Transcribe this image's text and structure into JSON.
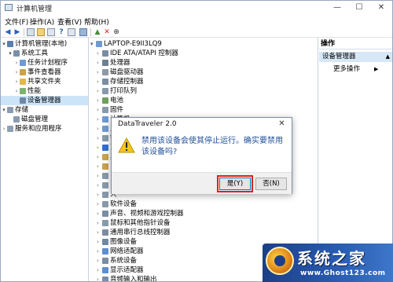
{
  "window": {
    "title": "计算机管理",
    "min": "—",
    "max": "☐",
    "close": "✕"
  },
  "menu": [
    "文件(F)",
    "操作(A)",
    "查看(V)",
    "帮助(H)"
  ],
  "tree": [
    {
      "label": "计算机管理(本地)",
      "arrow": "▾",
      "color": "#5b7fae"
    },
    {
      "label": "系统工具",
      "arrow": "▾",
      "color": "#7a8fa8"
    },
    {
      "label": "任务计划程序",
      "arrow": "›",
      "color": "#6e9ad1"
    },
    {
      "label": "事件查看器",
      "arrow": "›",
      "color": "#c9a24a"
    },
    {
      "label": "共享文件夹",
      "arrow": "›",
      "color": "#e3b84c"
    },
    {
      "label": "性能",
      "arrow": "›",
      "color": "#7fb26f"
    },
    {
      "label": "设备管理器",
      "arrow": "",
      "color": "#6f88a6",
      "selected": true
    },
    {
      "label": "存储",
      "arrow": "▾",
      "color": "#8b9bb0"
    },
    {
      "label": "磁盘管理",
      "arrow": "",
      "color": "#8b9bb0"
    },
    {
      "label": "服务和应用程序",
      "arrow": "›",
      "color": "#8fa0b4"
    }
  ],
  "devices": {
    "root": "LAPTOP-E9II3LQ9",
    "items": [
      {
        "label": "IDE ATA/ATAPI 控制器",
        "color": "#7b8da3"
      },
      {
        "label": "处理器",
        "color": "#6f7f92"
      },
      {
        "label": "磁盘驱动器",
        "color": "#8d99a6"
      },
      {
        "label": "存储控制器",
        "color": "#7b8da3"
      },
      {
        "label": "打印队列",
        "color": "#8899aa"
      },
      {
        "label": "电池",
        "color": "#6ea05a"
      },
      {
        "label": "固件",
        "color": "#8899aa"
      },
      {
        "label": "计算机",
        "color": "#6f9ad1"
      },
      {
        "label": "监",
        "color": "#6f9ad1"
      },
      {
        "label": "键",
        "color": "#8899aa"
      },
      {
        "label": "蓝",
        "color": "#2f6fd1"
      },
      {
        "label": "其",
        "color": "#c9a24a"
      },
      {
        "label": "",
        "color": "#c9a24a"
      },
      {
        "label": "",
        "color": "#8899aa"
      },
      {
        "label": "",
        "color": "#8899aa"
      },
      {
        "label": "人",
        "color": "#8899aa"
      },
      {
        "label": "软件设备",
        "color": "#8899aa"
      },
      {
        "label": "声音、视频和游戏控制器",
        "color": "#7b8da3"
      },
      {
        "label": "鼠标和其他指针设备",
        "color": "#8899aa"
      },
      {
        "label": "通用串行总线控制器",
        "color": "#7b8da3"
      },
      {
        "label": "图像设备",
        "color": "#6f88a6"
      },
      {
        "label": "网络适配器",
        "color": "#5b8fd1"
      },
      {
        "label": "系统设备",
        "color": "#7b8da3"
      },
      {
        "label": "显示适配器",
        "color": "#5b8fd1"
      },
      {
        "label": "音频输入和输出",
        "color": "#7b8da3"
      }
    ]
  },
  "actions": {
    "header": "操作",
    "section": "设备管理器",
    "more": "更多操作"
  },
  "dialog": {
    "title": "DataTraveler 2.0",
    "message": "禁用该设备会使其停止运行。确实要禁用该设备吗?",
    "yes": "是(Y)",
    "no": "否(N)",
    "close": "✕"
  },
  "watermark": {
    "title": "系统之家",
    "url": "www.Ghost123.com"
  }
}
